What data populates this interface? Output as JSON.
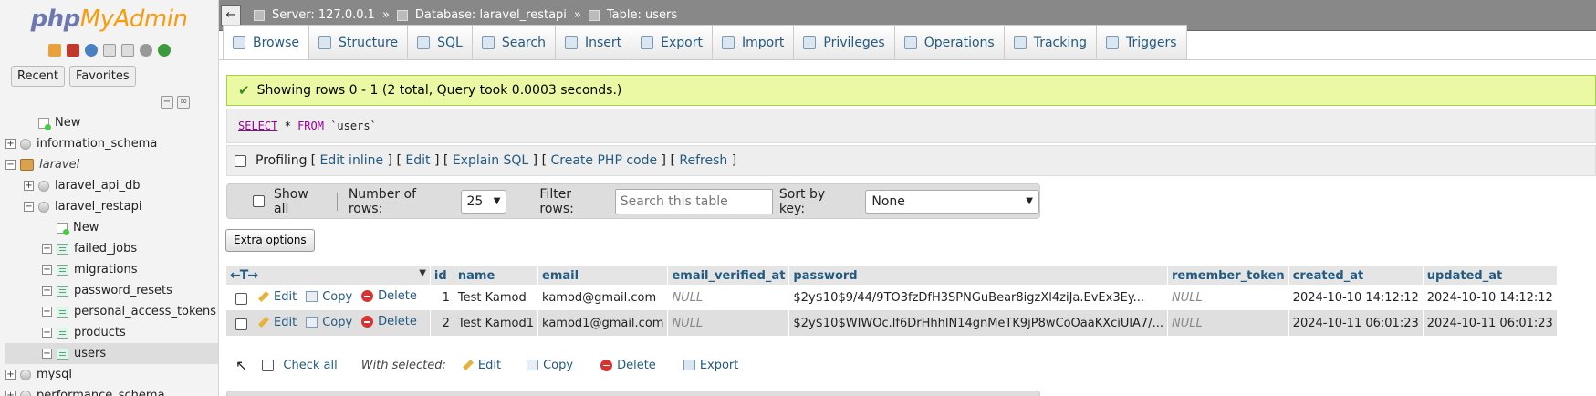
{
  "app": {
    "logo_php": "php",
    "logo_rest": "MyAdmin"
  },
  "sidebar": {
    "recent": "Recent",
    "favorites": "Favorites",
    "tree": [
      {
        "label": "New",
        "level": 1,
        "type": "new"
      },
      {
        "label": "information_schema",
        "level": 0,
        "type": "db",
        "expander": "+"
      },
      {
        "label": "laravel",
        "level": 0,
        "type": "laravel",
        "expander": "−",
        "italic": true
      },
      {
        "label": "laravel_api_db",
        "level": 1,
        "type": "db",
        "expander": "+"
      },
      {
        "label": "laravel_restapi",
        "level": 1,
        "type": "db",
        "expander": "−"
      },
      {
        "label": "New",
        "level": 2,
        "type": "new"
      },
      {
        "label": "failed_jobs",
        "level": 2,
        "type": "table",
        "expander": "+"
      },
      {
        "label": "migrations",
        "level": 2,
        "type": "table",
        "expander": "+"
      },
      {
        "label": "password_resets",
        "level": 2,
        "type": "table",
        "expander": "+"
      },
      {
        "label": "personal_access_tokens",
        "level": 2,
        "type": "table",
        "expander": "+"
      },
      {
        "label": "products",
        "level": 2,
        "type": "table",
        "expander": "+"
      },
      {
        "label": "users",
        "level": 2,
        "type": "table",
        "expander": "+",
        "active": true
      },
      {
        "label": "mysql",
        "level": 0,
        "type": "db",
        "expander": "+"
      },
      {
        "label": "performance_schema",
        "level": 0,
        "type": "db",
        "expander": "+"
      }
    ]
  },
  "breadcrumb": {
    "server": "Server: 127.0.0.1",
    "database": "Database: laravel_restapi",
    "table": "Table: users",
    "sep": "»"
  },
  "tabs": [
    "Browse",
    "Structure",
    "SQL",
    "Search",
    "Insert",
    "Export",
    "Import",
    "Privileges",
    "Operations",
    "Tracking",
    "Triggers"
  ],
  "success_message": "Showing rows 0 - 1 (2 total, Query took 0.0003 seconds.)",
  "sql": {
    "kw": "SELECT",
    "star": "*",
    "from": "FROM",
    "table": "`users`"
  },
  "profiling": {
    "label": "Profiling",
    "links": [
      "Edit inline",
      "Edit",
      "Explain SQL",
      "Create PHP code",
      "Refresh"
    ]
  },
  "nav": {
    "show_all": "Show all",
    "rows_label": "Number of rows:",
    "rows_value": "25",
    "filter_label": "Filter rows:",
    "filter_placeholder": "Search this table",
    "sort_label": "Sort by key:",
    "sort_value": "None"
  },
  "extra_options": "Extra options",
  "table": {
    "arrows": "←T→",
    "columns": [
      "id",
      "name",
      "email",
      "email_verified_at",
      "password",
      "remember_token",
      "created_at",
      "updated_at"
    ],
    "actions": {
      "edit": "Edit",
      "copy": "Copy",
      "delete": "Delete"
    },
    "rows": [
      {
        "id": "1",
        "name": "Test Kamod",
        "email": "kamod@gmail.com",
        "email_verified_at": "NULL",
        "password": "$2y$10$9/44/9TO3fzDfH3SPNGuBear8igzXl4ziJa.EvEx3Ey...",
        "remember_token": "NULL",
        "created_at": "2024-10-10 14:12:12",
        "updated_at": "2024-10-10 14:12:12"
      },
      {
        "id": "2",
        "name": "Test Kamod1",
        "email": "kamod1@gmail.com",
        "email_verified_at": "NULL",
        "password": "$2y$10$WIWOc.lf6DrHhhlN14gnMeTK9jP8wCoOaaKXciUlA7/...",
        "remember_token": "NULL",
        "created_at": "2024-10-11 06:01:23",
        "updated_at": "2024-10-11 06:01:23"
      }
    ]
  },
  "bulk": {
    "check_all": "Check all",
    "with_selected": "With selected:",
    "edit": "Edit",
    "copy": "Copy",
    "delete": "Delete",
    "export": "Export"
  }
}
